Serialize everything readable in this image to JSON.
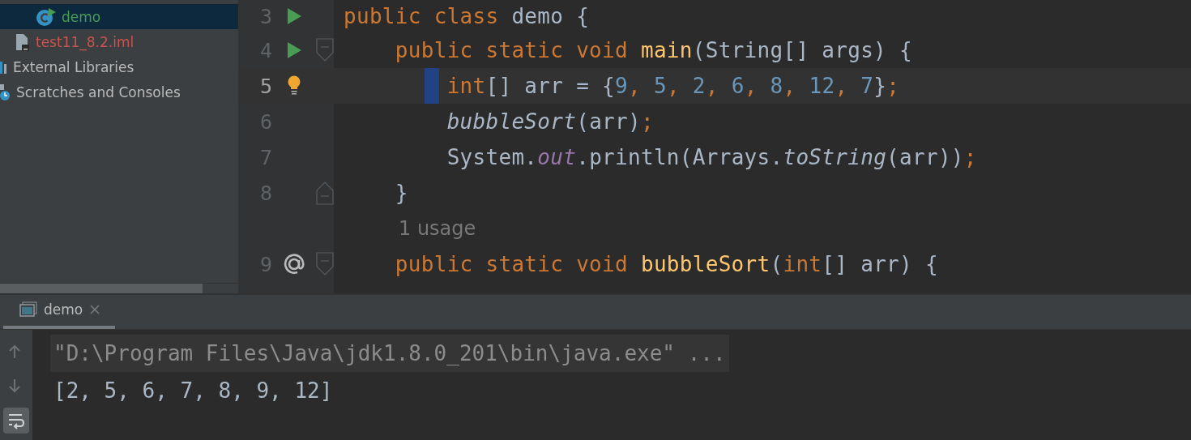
{
  "project_tree": {
    "items": [
      {
        "label": "demo",
        "kind": "class",
        "selected": true,
        "color": "#499c54"
      },
      {
        "label": "test11_8.2.iml",
        "kind": "iml",
        "selected": false,
        "color": "#c75450"
      },
      {
        "label": "External Libraries",
        "kind": "libraries",
        "selected": false,
        "color": "#bbbbbb"
      },
      {
        "label": "Scratches and Consoles",
        "kind": "scratches",
        "selected": false,
        "color": "#bbbbbb"
      }
    ]
  },
  "editor": {
    "lines": [
      {
        "number": "3",
        "marker": {
          "kind": "run"
        },
        "current": false,
        "tokens": [
          {
            "kind": "kw",
            "text": "public class "
          },
          {
            "kind": "plain",
            "text": "demo {"
          }
        ]
      },
      {
        "number": "4",
        "marker": {
          "kind": "run"
        },
        "fold": {
          "kind": "start"
        },
        "current": false,
        "tokens": [
          {
            "kind": "kw",
            "text": "    public static void "
          },
          {
            "kind": "decl",
            "text": "main"
          },
          {
            "kind": "plain",
            "text": "(String[] args) {"
          }
        ]
      },
      {
        "number": "5",
        "marker": {
          "kind": "bulb"
        },
        "current": true,
        "caret": true,
        "tokens": [
          {
            "kind": "kw",
            "text": "        int"
          },
          {
            "kind": "plain",
            "text": "[] arr = {"
          },
          {
            "kind": "num",
            "text": "9"
          },
          {
            "kind": "kw",
            "text": ", "
          },
          {
            "kind": "num",
            "text": "5"
          },
          {
            "kind": "kw",
            "text": ", "
          },
          {
            "kind": "num",
            "text": "2"
          },
          {
            "kind": "kw",
            "text": ", "
          },
          {
            "kind": "num",
            "text": "6"
          },
          {
            "kind": "kw",
            "text": ", "
          },
          {
            "kind": "num",
            "text": "8"
          },
          {
            "kind": "kw",
            "text": ", "
          },
          {
            "kind": "num",
            "text": "12"
          },
          {
            "kind": "kw",
            "text": ", "
          },
          {
            "kind": "num",
            "text": "7"
          },
          {
            "kind": "plain",
            "text": "}"
          },
          {
            "kind": "kw",
            "text": ";"
          }
        ]
      },
      {
        "number": "6",
        "current": false,
        "tokens": [
          {
            "kind": "call",
            "text": "        bubbleSort"
          },
          {
            "kind": "plain",
            "text": "(arr)"
          },
          {
            "kind": "kw",
            "text": ";"
          }
        ]
      },
      {
        "number": "7",
        "current": false,
        "tokens": [
          {
            "kind": "plain",
            "text": "        System."
          },
          {
            "kind": "field",
            "text": "out"
          },
          {
            "kind": "plain",
            "text": ".println(Arrays."
          },
          {
            "kind": "call",
            "text": "toString"
          },
          {
            "kind": "plain",
            "text": "(arr))"
          },
          {
            "kind": "kw",
            "text": ";"
          }
        ]
      },
      {
        "number": "8",
        "fold": {
          "kind": "end"
        },
        "current": false,
        "tokens": [
          {
            "kind": "plain",
            "text": "    }"
          }
        ]
      },
      {
        "kind": "hint",
        "text": "1 usage"
      },
      {
        "number": "9",
        "marker": {
          "kind": "override"
        },
        "fold": {
          "kind": "start"
        },
        "current": false,
        "tokens": [
          {
            "kind": "kw",
            "text": "    public static void "
          },
          {
            "kind": "decl",
            "text": "bubbleSort"
          },
          {
            "kind": "plain",
            "text": "("
          },
          {
            "kind": "kw",
            "text": "int"
          },
          {
            "kind": "plain",
            "text": "[] arr) {"
          }
        ]
      }
    ]
  },
  "run_panel": {
    "tabs": [
      {
        "label": "demo",
        "selected": true
      }
    ],
    "toolbar": [
      {
        "kind": "up",
        "selected": false
      },
      {
        "kind": "down",
        "selected": false
      },
      {
        "kind": "wrap",
        "selected": true
      }
    ],
    "console": [
      {
        "kind": "command",
        "text": "\"D:\\Program Files\\Java\\jdk1.8.0_201\\bin\\java.exe\" ..."
      },
      {
        "kind": "output",
        "text": "[2, 5, 6, 7, 8, 9, 12]"
      }
    ]
  }
}
